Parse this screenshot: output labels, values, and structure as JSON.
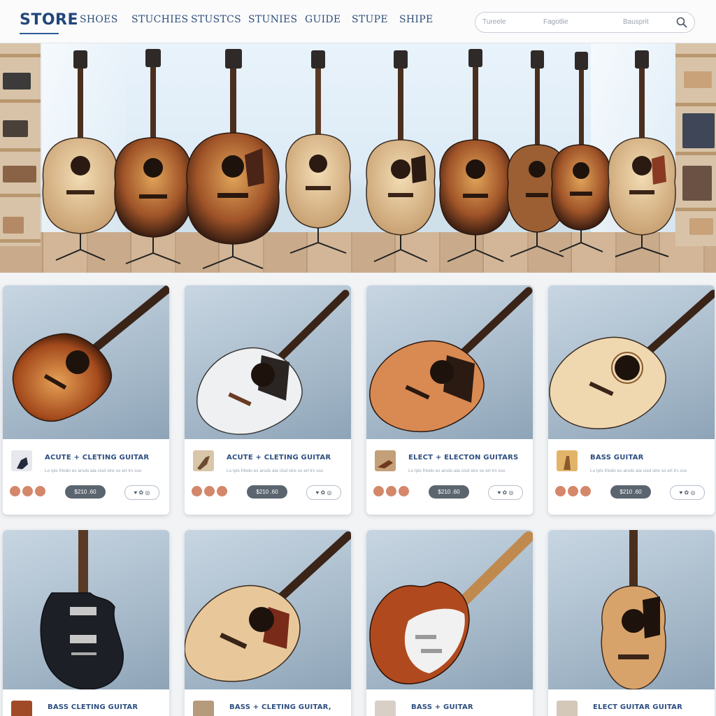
{
  "nav": {
    "logo": "STORE",
    "links": [
      "SHOES",
      "STUCHIES",
      "STUSTCS",
      "STUNIES",
      "GUIDE",
      "STUPE",
      "SHIPE"
    ],
    "search_segments": [
      "Tureele",
      "Fagotlie",
      "Bausprit"
    ]
  },
  "products": [
    {
      "title": "ACUTE + CLETING GUITAR",
      "desc": "Lo lpls frlodo es arsds ala cisd stre so ert lrs sso",
      "price": "$210 .60",
      "cart": "♥ ✿ ◎"
    },
    {
      "title": "ACUTE + CLETING GUITAR",
      "desc": "Lo lpls frlodo es arsds ala cisd stre so ert lrs sso",
      "price": "$210 .60",
      "cart": "♥ ✿ ◎"
    },
    {
      "title": "ELECT + ELECTON GUITARS",
      "desc": "Lo lpls frlodo es arsds ala cisd stre so ert lrs sso",
      "price": "$210 .60",
      "cart": "♥ ✿ ◎"
    },
    {
      "title": "BASS GUITAR",
      "desc": "Lo lpls frlodo es arsds ala cisd stre so ert lrs sso",
      "price": "$210 .60",
      "cart": "♥ ✿ ◎"
    },
    {
      "title": "BASS CLETING GUITAR",
      "desc": "",
      "price": "",
      "cart": ""
    },
    {
      "title": "BASS + CLETING GUITAR,",
      "desc": "",
      "price": "",
      "cart": ""
    },
    {
      "title": "BASS + GUITAR",
      "desc": "",
      "price": "",
      "cart": ""
    },
    {
      "title": "ELECT GUITAR GUITAR",
      "desc": "",
      "price": "",
      "cart": ""
    }
  ],
  "colors": {
    "brand": "#22467a",
    "swatch": "#d4876a",
    "price_button": "#5b6570"
  }
}
